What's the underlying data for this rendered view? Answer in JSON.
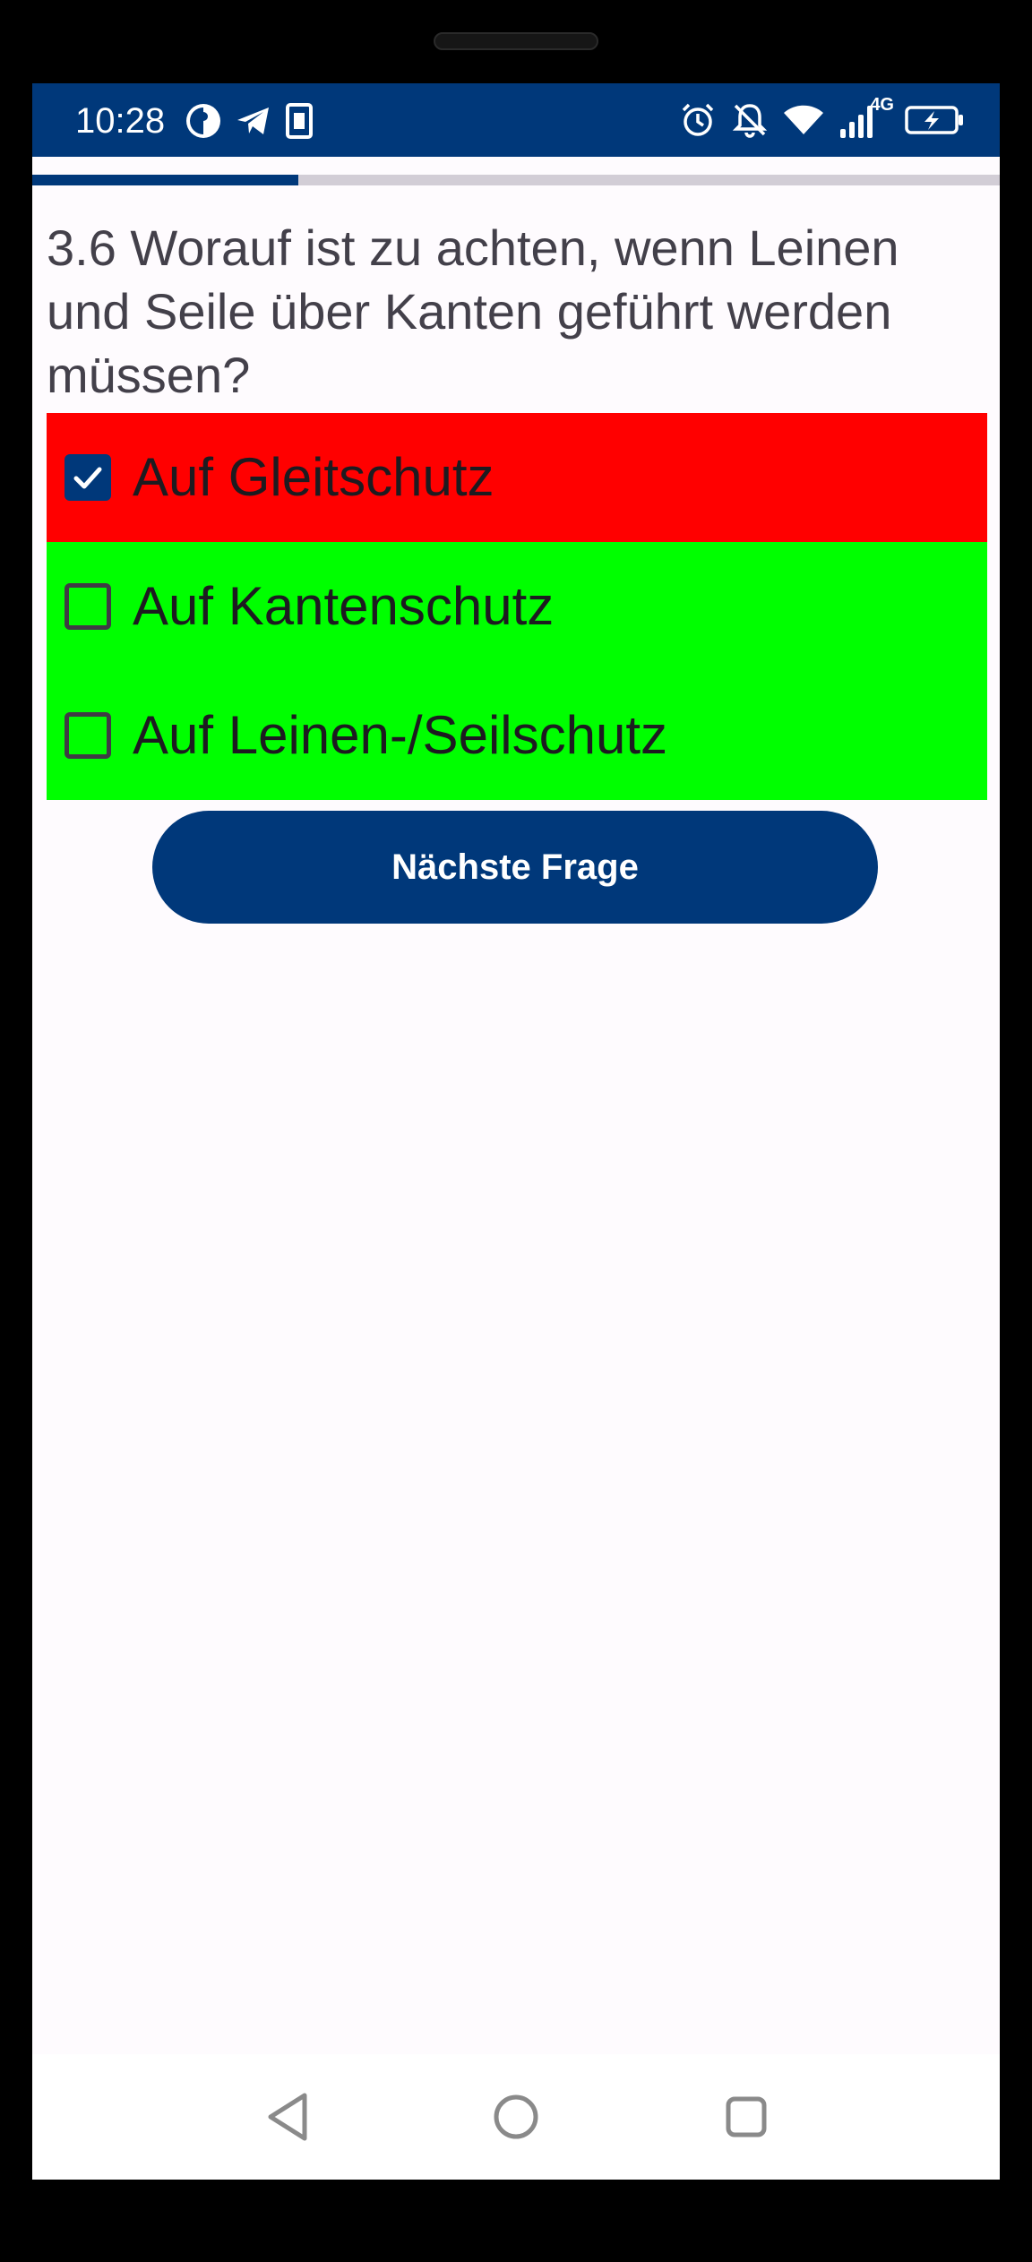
{
  "status_bar": {
    "time": "10:28",
    "network_label": "4G",
    "left_icons": [
      "app-notification-icon",
      "telegram-icon",
      "sim-card-icon"
    ],
    "right_icons": [
      "alarm-icon",
      "notifications-off-icon",
      "wifi-icon",
      "signal-icon",
      "battery-charging-icon"
    ]
  },
  "progress": {
    "value": 0.275
  },
  "question": {
    "text": "3.6 Worauf ist zu achten, wenn Leinen und Seile über Kanten geführt werden müssen?"
  },
  "answers": [
    {
      "label": "Auf Gleitschutz",
      "checked": true,
      "status": "wrong"
    },
    {
      "label": "Auf Kantenschutz",
      "checked": false,
      "status": "correct"
    },
    {
      "label": "Auf Leinen-/Seilschutz",
      "checked": false,
      "status": "correct"
    }
  ],
  "next_button": {
    "label": "Nächste Frage"
  },
  "nav_bar": {
    "icons": [
      "back-icon",
      "home-icon",
      "recents-icon"
    ]
  },
  "colors": {
    "primary": "#00387a",
    "wrong_answer": "#ff0000",
    "correct_answer": "#00ff00",
    "background": "#fefbfe",
    "question_text": "#43404a"
  }
}
